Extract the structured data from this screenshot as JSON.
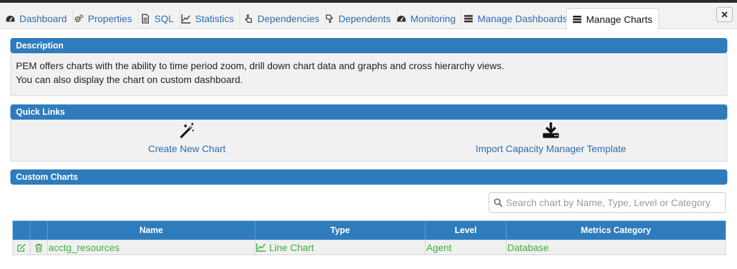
{
  "tabs": [
    {
      "label": "Dashboard",
      "icon": "dashboard-icon",
      "active": false
    },
    {
      "label": "Properties",
      "icon": "cogs-icon",
      "active": false
    },
    {
      "label": "SQL",
      "icon": "file-icon",
      "active": false
    },
    {
      "label": "Statistics",
      "icon": "line-chart-icon",
      "active": false
    },
    {
      "label": "Dependencies",
      "icon": "hand-pointer-icon",
      "active": false
    },
    {
      "label": "Dependents",
      "icon": "hand-up-icon",
      "active": false
    },
    {
      "label": "Monitoring",
      "icon": "dashboard-icon",
      "active": false
    },
    {
      "label": "Manage Dashboards",
      "icon": "list-icon",
      "active": false
    },
    {
      "label": "Manage Charts",
      "icon": "list-icon",
      "active": true
    }
  ],
  "description": {
    "title": "Description",
    "line1": "PEM offers charts with the ability to time period zoom, drill down chart data and graphs and cross hierarchy views.",
    "line2": "You can also display the chart on custom dashboard."
  },
  "quick_links": {
    "title": "Quick Links",
    "create_label": "Create New Chart",
    "create_icon": "magic-wand-icon",
    "import_label": "Import Capacity Manager Template",
    "import_icon": "download-icon"
  },
  "custom_charts": {
    "title": "Custom Charts",
    "search_placeholder": "Search chart by Name, Type, Level or Category",
    "columns": [
      "Name",
      "Type",
      "Level",
      "Metrics Category"
    ],
    "rows": [
      {
        "name": "acctg_resources",
        "type": "Line Chart",
        "level": "Agent",
        "category": "Database"
      }
    ]
  },
  "colors": {
    "accent": "#2f7cbd",
    "link": "#2b6cb0",
    "row_text": "#3cae3c"
  }
}
